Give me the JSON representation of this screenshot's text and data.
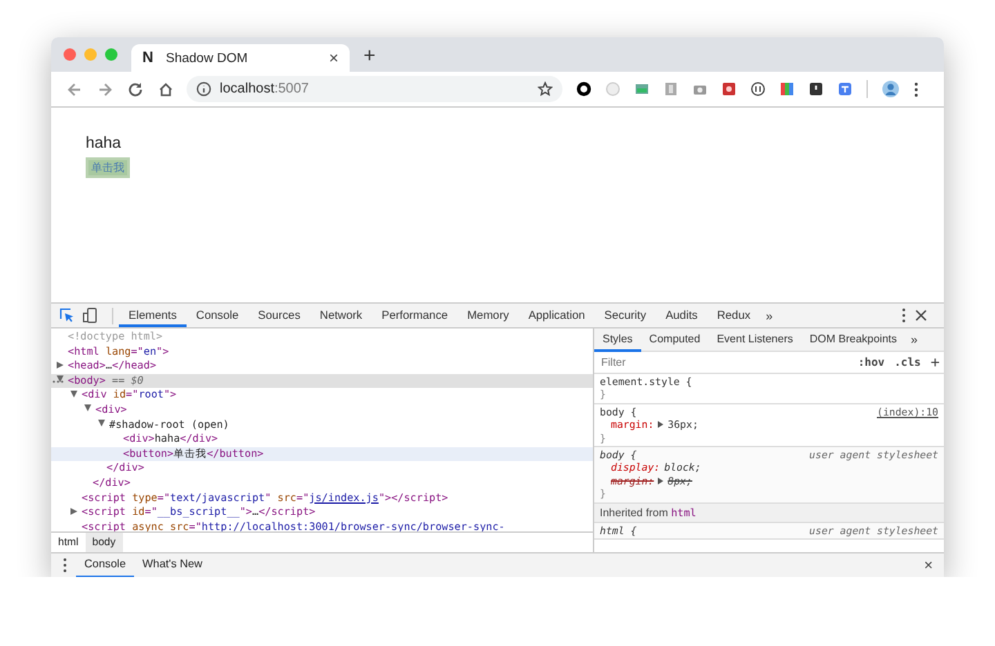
{
  "browser": {
    "tab": {
      "favicon": "N",
      "title": "Shadow DOM",
      "close": "×"
    },
    "new_tab": "+",
    "address": {
      "host": "localhost",
      "port": ":5007"
    }
  },
  "page": {
    "text": "haha",
    "button": {
      "label": "单击我",
      "highlighted": true
    }
  },
  "devtools": {
    "tabs": [
      {
        "label": "Elements",
        "selected": true
      },
      {
        "label": "Console",
        "selected": false
      },
      {
        "label": "Sources",
        "selected": false
      },
      {
        "label": "Network",
        "selected": false
      },
      {
        "label": "Performance",
        "selected": false
      },
      {
        "label": "Memory",
        "selected": false
      },
      {
        "label": "Application",
        "selected": false
      },
      {
        "label": "Security",
        "selected": false
      },
      {
        "label": "Audits",
        "selected": false
      },
      {
        "label": "Redux",
        "selected": false
      }
    ],
    "more": "»",
    "dom_tree": [
      {
        "text": "<!doctype html>"
      },
      {
        "text": "<html lang=\"en\">"
      },
      {
        "text": "<head>…</head>",
        "expanded": false
      },
      {
        "text": "<body>",
        "note": " == $0",
        "expanded": true,
        "selected": true,
        "children": [
          {
            "text": "<div id=\"root\">",
            "expanded": true,
            "close": "</div>",
            "children": [
              {
                "text": "<div>",
                "expanded": true,
                "close": "</div>",
                "children": [
                  {
                    "text": "#shadow-root (open)",
                    "expanded": true,
                    "children": [
                      {
                        "text": "<div>haha</div>",
                        "highlighted": false
                      },
                      {
                        "text": "<button>单击我</button>",
                        "highlighted": true
                      }
                    ]
                  }
                ]
              }
            ]
          },
          {
            "text": "<script type=\"text/javascript\" src=\"",
            "link": "js/index.js",
            "after": "\"></script>"
          },
          {
            "text": "<script id=\"__bs_script__\">…</script>",
            "expanded": false
          },
          {
            "text": "<script async src=\"http://localhost:3001/browser-sync/browser-sync-"
          }
        ]
      }
    ],
    "breadcrumbs": [
      {
        "label": "html",
        "selected": false
      },
      {
        "label": "body",
        "selected": true
      }
    ],
    "styles": {
      "tabs": [
        {
          "label": "Styles",
          "selected": true
        },
        {
          "label": "Computed",
          "selected": false
        },
        {
          "label": "Event Listeners",
          "selected": false
        },
        {
          "label": "DOM Breakpoints",
          "selected": false
        }
      ],
      "more": "»",
      "filter": {
        "placeholder": "Filter"
      },
      "hov": ":hov",
      "cls": ".cls",
      "add": "+",
      "rules": [
        {
          "kind": "inline",
          "selector": "element.style {",
          "close": "}"
        },
        {
          "kind": "author",
          "selector": "body {",
          "source": "(index):10",
          "close": "}",
          "declarations": [
            {
              "property": "margin:",
              "value": "36px;",
              "expandable": true,
              "overridden": false
            }
          ]
        },
        {
          "kind": "user-agent",
          "selector": "body {",
          "source": "user agent stylesheet",
          "close": "}",
          "declarations": [
            {
              "property": "display:",
              "value": "block;",
              "expandable": false,
              "overridden": false
            },
            {
              "property": "margin:",
              "value": "8px;",
              "expandable": true,
              "overridden": true
            }
          ]
        },
        {
          "kind": "inherited",
          "label": "Inherited from ",
          "element": "html"
        },
        {
          "kind": "user-agent",
          "selector": "html {",
          "source": "user agent stylesheet"
        }
      ]
    },
    "drawer": {
      "tabs": [
        {
          "label": "Console",
          "selected": true
        },
        {
          "label": "What's New",
          "selected": false
        }
      ],
      "close": "×"
    }
  }
}
